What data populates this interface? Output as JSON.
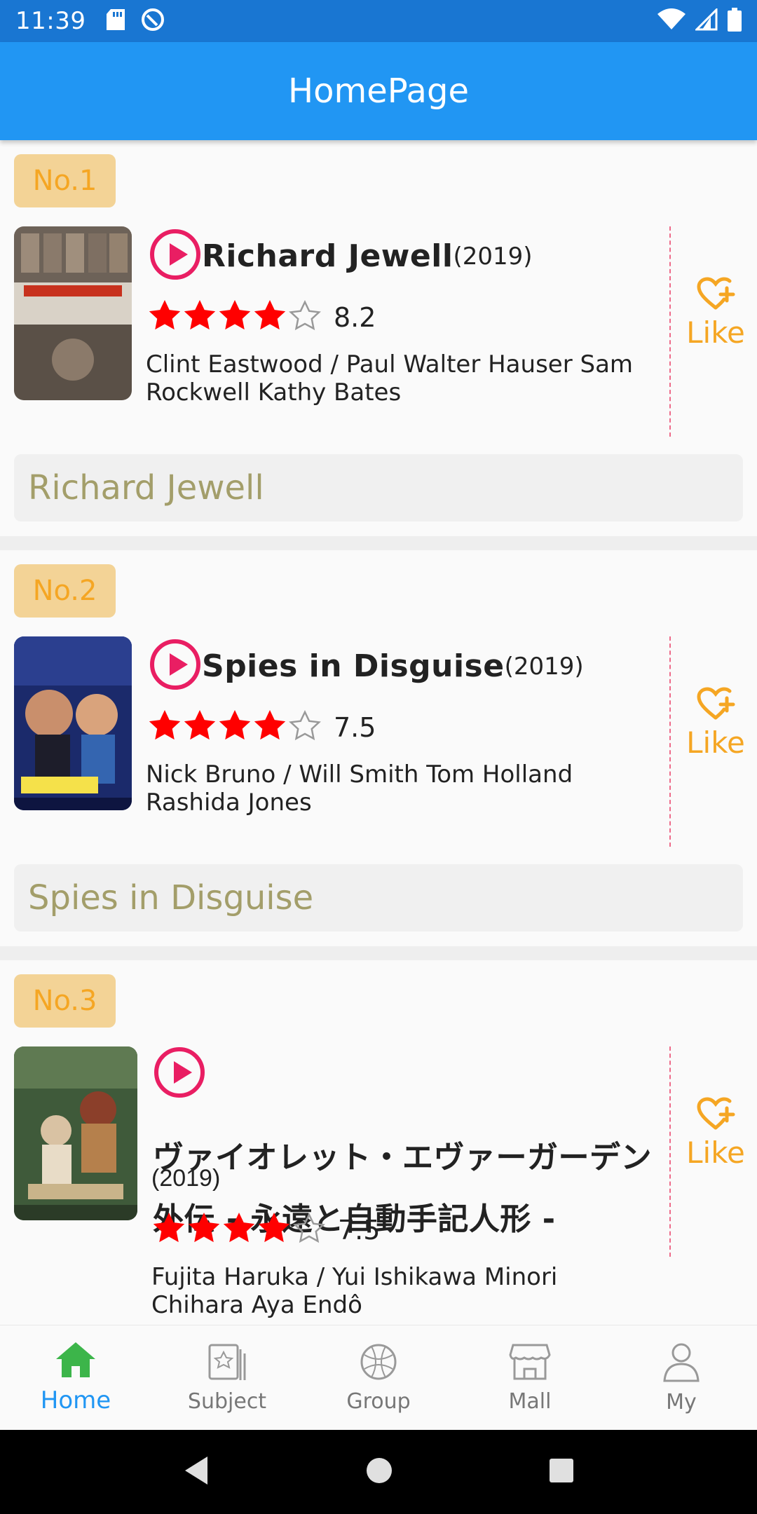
{
  "status_bar": {
    "time": "11:39"
  },
  "app_bar": {
    "title": "HomePage"
  },
  "movies": [
    {
      "rank": "No.1",
      "title": "Richard Jewell",
      "year": "(2019)",
      "rating": "8.2",
      "stars": 4,
      "cast": "Clint Eastwood / Paul Walter Hauser Sam Rockwell Kathy Bates",
      "like_label": "Like",
      "summary": "Richard Jewell"
    },
    {
      "rank": "No.2",
      "title": "Spies in Disguise",
      "year": "(2019)",
      "rating": "7.5",
      "stars": 4,
      "cast": "Nick Bruno / Will Smith Tom Holland Rashida Jones",
      "like_label": "Like",
      "summary": "Spies in Disguise"
    },
    {
      "rank": "No.3",
      "title": "ヴァイオレット・エヴァーガーデン 外伝 - 永遠と自動手記人形 -",
      "year": "(2019)",
      "rating": "7.5",
      "stars": 4,
      "cast": "Fujita Haruka / Yui Ishikawa Minori Chihara Aya Endô",
      "like_label": "Like",
      "summary": ""
    }
  ],
  "bottom_nav": [
    {
      "label": "Home",
      "icon": "home-icon",
      "active": true
    },
    {
      "label": "Subject",
      "icon": "subject-icon",
      "active": false
    },
    {
      "label": "Group",
      "icon": "group-icon",
      "active": false
    },
    {
      "label": "Mall",
      "icon": "mall-icon",
      "active": false
    },
    {
      "label": "My",
      "icon": "profile-icon",
      "active": false
    }
  ],
  "colors": {
    "app_bar": "#2196f3",
    "status_bar": "#1976d2",
    "accent_like": "#f5a623",
    "play": "#e91e63",
    "star": "#ff0000",
    "active_nav": "#2196f3"
  }
}
